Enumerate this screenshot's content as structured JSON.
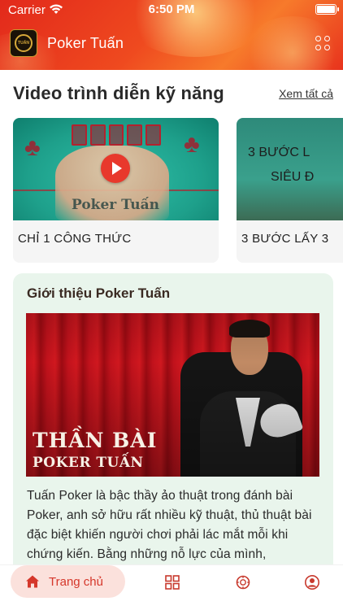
{
  "status": {
    "carrier": "Carrier",
    "time": "6:50 PM"
  },
  "app": {
    "title": "Poker Tuấn",
    "logo_text": "TUẤN"
  },
  "skills": {
    "title": "Video trình diễn kỹ năng",
    "see_all": "Xem tất cả",
    "videos": [
      {
        "caption": "CHỈ 1 CÔNG THỨC",
        "thumb_text": "Poker Tuấn"
      },
      {
        "caption": "3 BƯỚC LẤY 3",
        "thumb_line1": "3 BƯỚC L",
        "thumb_line2": "SIÊU Đ"
      }
    ]
  },
  "intro": {
    "title": "Giới thiệu Poker Tuấn",
    "banner_line1": "THẦN BÀI",
    "banner_line2": "POKER TUẤN",
    "text": "Tuấn Poker là bậc thầy ảo thuật trong đánh bài Poker, anh sở hữu rất nhiều kỹ thuật, thủ thuật bài đặc biệt khiến người chơi phải lác mắt mỗi khi chứng kiến. Bằng những nỗ lực của mình,"
  },
  "tabs": {
    "home_label": "Trang chủ"
  },
  "colors": {
    "accent": "#d5372b",
    "header_start": "#e2291b",
    "header_end": "#f77a2b",
    "intro_bg": "#e9f5ec"
  }
}
